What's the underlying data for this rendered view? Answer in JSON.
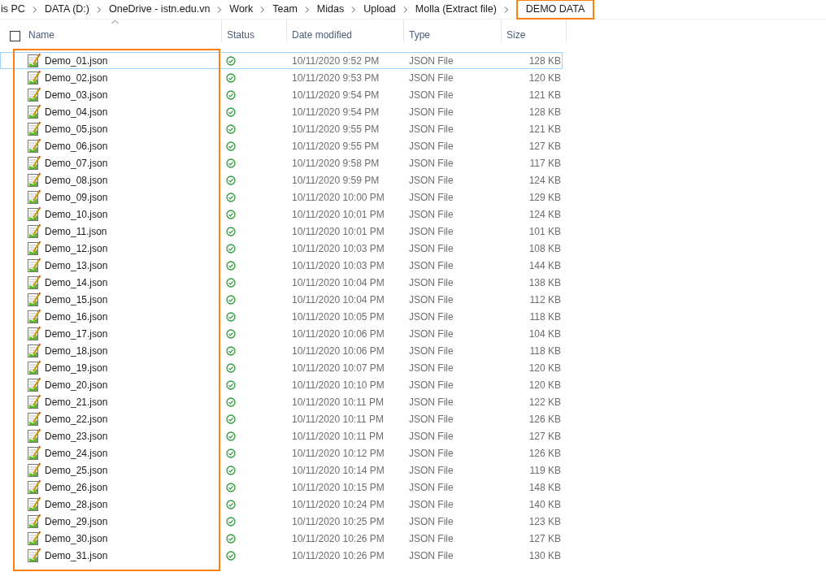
{
  "breadcrumb": [
    {
      "label": "is PC",
      "highlighted": false
    },
    {
      "label": "DATA (D:)",
      "highlighted": false
    },
    {
      "label": "OneDrive - istn.edu.vn",
      "highlighted": false
    },
    {
      "label": "Work",
      "highlighted": false
    },
    {
      "label": "Team",
      "highlighted": false
    },
    {
      "label": "Midas",
      "highlighted": false
    },
    {
      "label": "Upload",
      "highlighted": false
    },
    {
      "label": "Molla (Extract file)",
      "highlighted": false
    },
    {
      "label": "DEMO DATA",
      "highlighted": true
    }
  ],
  "table": {
    "select_all_checked": false,
    "name_column_highlighted": true,
    "columns": [
      {
        "label": "Name",
        "sorted": true
      },
      {
        "label": "Status",
        "sorted": false
      },
      {
        "label": "Date modified",
        "sorted": false
      },
      {
        "label": "Type",
        "sorted": false
      },
      {
        "label": "Size",
        "sorted": false
      }
    ],
    "rows": [
      {
        "name": "Demo_01.json",
        "synced": true,
        "date": "10/11/2020 9:52 PM",
        "type": "JSON File",
        "size": "128 KB",
        "focused": true
      },
      {
        "name": "Demo_02.json",
        "synced": true,
        "date": "10/11/2020 9:53 PM",
        "type": "JSON File",
        "size": "120 KB",
        "focused": false
      },
      {
        "name": "Demo_03.json",
        "synced": true,
        "date": "10/11/2020 9:54 PM",
        "type": "JSON File",
        "size": "121 KB",
        "focused": false
      },
      {
        "name": "Demo_04.json",
        "synced": true,
        "date": "10/11/2020 9:54 PM",
        "type": "JSON File",
        "size": "128 KB",
        "focused": false
      },
      {
        "name": "Demo_05.json",
        "synced": true,
        "date": "10/11/2020 9:55 PM",
        "type": "JSON File",
        "size": "121 KB",
        "focused": false
      },
      {
        "name": "Demo_06.json",
        "synced": true,
        "date": "10/11/2020 9:55 PM",
        "type": "JSON File",
        "size": "127 KB",
        "focused": false
      },
      {
        "name": "Demo_07.json",
        "synced": true,
        "date": "10/11/2020 9:58 PM",
        "type": "JSON File",
        "size": "117 KB",
        "focused": false
      },
      {
        "name": "Demo_08.json",
        "synced": true,
        "date": "10/11/2020 9:59 PM",
        "type": "JSON File",
        "size": "124 KB",
        "focused": false
      },
      {
        "name": "Demo_09.json",
        "synced": true,
        "date": "10/11/2020 10:00 PM",
        "type": "JSON File",
        "size": "129 KB",
        "focused": false
      },
      {
        "name": "Demo_10.json",
        "synced": true,
        "date": "10/11/2020 10:01 PM",
        "type": "JSON File",
        "size": "124 KB",
        "focused": false
      },
      {
        "name": "Demo_11.json",
        "synced": true,
        "date": "10/11/2020 10:01 PM",
        "type": "JSON File",
        "size": "101 KB",
        "focused": false
      },
      {
        "name": "Demo_12.json",
        "synced": true,
        "date": "10/11/2020 10:03 PM",
        "type": "JSON File",
        "size": "108 KB",
        "focused": false
      },
      {
        "name": "Demo_13.json",
        "synced": true,
        "date": "10/11/2020 10:03 PM",
        "type": "JSON File",
        "size": "144 KB",
        "focused": false
      },
      {
        "name": "Demo_14.json",
        "synced": true,
        "date": "10/11/2020 10:04 PM",
        "type": "JSON File",
        "size": "138 KB",
        "focused": false
      },
      {
        "name": "Demo_15.json",
        "synced": true,
        "date": "10/11/2020 10:04 PM",
        "type": "JSON File",
        "size": "112 KB",
        "focused": false
      },
      {
        "name": "Demo_16.json",
        "synced": true,
        "date": "10/11/2020 10:05 PM",
        "type": "JSON File",
        "size": "118 KB",
        "focused": false
      },
      {
        "name": "Demo_17.json",
        "synced": true,
        "date": "10/11/2020 10:06 PM",
        "type": "JSON File",
        "size": "104 KB",
        "focused": false
      },
      {
        "name": "Demo_18.json",
        "synced": true,
        "date": "10/11/2020 10:06 PM",
        "type": "JSON File",
        "size": "118 KB",
        "focused": false
      },
      {
        "name": "Demo_19.json",
        "synced": true,
        "date": "10/11/2020 10:07 PM",
        "type": "JSON File",
        "size": "120 KB",
        "focused": false
      },
      {
        "name": "Demo_20.json",
        "synced": true,
        "date": "10/11/2020 10:10 PM",
        "type": "JSON File",
        "size": "120 KB",
        "focused": false
      },
      {
        "name": "Demo_21.json",
        "synced": true,
        "date": "10/11/2020 10:11 PM",
        "type": "JSON File",
        "size": "122 KB",
        "focused": false
      },
      {
        "name": "Demo_22.json",
        "synced": true,
        "date": "10/11/2020 10:11 PM",
        "type": "JSON File",
        "size": "126 KB",
        "focused": false
      },
      {
        "name": "Demo_23.json",
        "synced": true,
        "date": "10/11/2020 10:11 PM",
        "type": "JSON File",
        "size": "127 KB",
        "focused": false
      },
      {
        "name": "Demo_24.json",
        "synced": true,
        "date": "10/11/2020 10:12 PM",
        "type": "JSON File",
        "size": "126 KB",
        "focused": false
      },
      {
        "name": "Demo_25.json",
        "synced": true,
        "date": "10/11/2020 10:14 PM",
        "type": "JSON File",
        "size": "119 KB",
        "focused": false
      },
      {
        "name": "Demo_26.json",
        "synced": true,
        "date": "10/11/2020 10:15 PM",
        "type": "JSON File",
        "size": "148 KB",
        "focused": false
      },
      {
        "name": "Demo_28.json",
        "synced": true,
        "date": "10/11/2020 10:24 PM",
        "type": "JSON File",
        "size": "140 KB",
        "focused": false
      },
      {
        "name": "Demo_29.json",
        "synced": true,
        "date": "10/11/2020 10:25 PM",
        "type": "JSON File",
        "size": "123 KB",
        "focused": false
      },
      {
        "name": "Demo_30.json",
        "synced": true,
        "date": "10/11/2020 10:26 PM",
        "type": "JSON File",
        "size": "127 KB",
        "focused": false
      },
      {
        "name": "Demo_31.json",
        "synced": true,
        "date": "10/11/2020 10:26 PM",
        "type": "JSON File",
        "size": "130 KB",
        "focused": false
      }
    ]
  }
}
